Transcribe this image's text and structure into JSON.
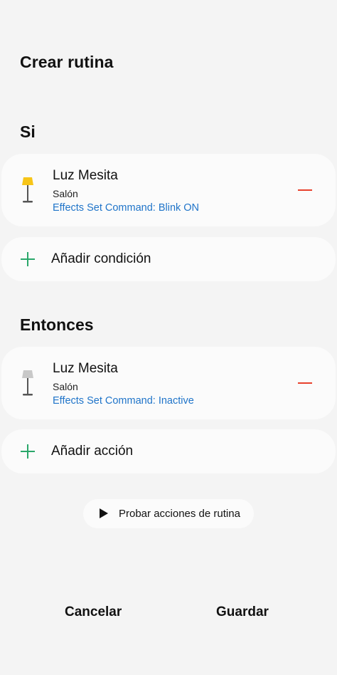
{
  "header": {
    "title": "Crear rutina"
  },
  "if_section": {
    "title": "Si",
    "device": {
      "name": "Luz Mesita",
      "room": "Salón",
      "command": "Effects Set Command: Blink ON",
      "icon": "floor-lamp-on-icon",
      "lamp_color": "#f7c518"
    },
    "add_label": "Añadir condición"
  },
  "then_section": {
    "title": "Entonces",
    "device": {
      "name": "Luz Mesita",
      "room": "Salón",
      "command": "Effects Set Command: Inactive",
      "icon": "floor-lamp-off-icon",
      "lamp_color": "#c8c8c8"
    },
    "add_label": "Añadir acción"
  },
  "test_button": {
    "label": "Probar acciones de rutina",
    "icon": "play-icon"
  },
  "footer": {
    "cancel_label": "Cancelar",
    "save_label": "Guardar"
  },
  "colors": {
    "background": "#f4f4f4",
    "card": "#fbfbfb",
    "link_blue": "#1f74c9",
    "remove_red": "#e8412c",
    "add_green": "#2aa76a"
  }
}
